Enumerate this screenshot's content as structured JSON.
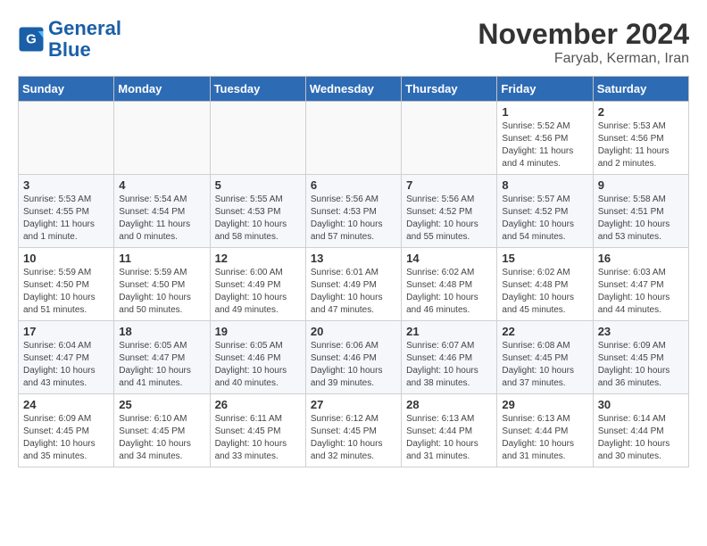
{
  "logo": {
    "line1": "General",
    "line2": "Blue"
  },
  "title": "November 2024",
  "subtitle": "Faryab, Kerman, Iran",
  "headers": [
    "Sunday",
    "Monday",
    "Tuesday",
    "Wednesday",
    "Thursday",
    "Friday",
    "Saturday"
  ],
  "weeks": [
    [
      {
        "day": "",
        "text": ""
      },
      {
        "day": "",
        "text": ""
      },
      {
        "day": "",
        "text": ""
      },
      {
        "day": "",
        "text": ""
      },
      {
        "day": "",
        "text": ""
      },
      {
        "day": "1",
        "text": "Sunrise: 5:52 AM\nSunset: 4:56 PM\nDaylight: 11 hours\nand 4 minutes."
      },
      {
        "day": "2",
        "text": "Sunrise: 5:53 AM\nSunset: 4:56 PM\nDaylight: 11 hours\nand 2 minutes."
      }
    ],
    [
      {
        "day": "3",
        "text": "Sunrise: 5:53 AM\nSunset: 4:55 PM\nDaylight: 11 hours\nand 1 minute."
      },
      {
        "day": "4",
        "text": "Sunrise: 5:54 AM\nSunset: 4:54 PM\nDaylight: 11 hours\nand 0 minutes."
      },
      {
        "day": "5",
        "text": "Sunrise: 5:55 AM\nSunset: 4:53 PM\nDaylight: 10 hours\nand 58 minutes."
      },
      {
        "day": "6",
        "text": "Sunrise: 5:56 AM\nSunset: 4:53 PM\nDaylight: 10 hours\nand 57 minutes."
      },
      {
        "day": "7",
        "text": "Sunrise: 5:56 AM\nSunset: 4:52 PM\nDaylight: 10 hours\nand 55 minutes."
      },
      {
        "day": "8",
        "text": "Sunrise: 5:57 AM\nSunset: 4:52 PM\nDaylight: 10 hours\nand 54 minutes."
      },
      {
        "day": "9",
        "text": "Sunrise: 5:58 AM\nSunset: 4:51 PM\nDaylight: 10 hours\nand 53 minutes."
      }
    ],
    [
      {
        "day": "10",
        "text": "Sunrise: 5:59 AM\nSunset: 4:50 PM\nDaylight: 10 hours\nand 51 minutes."
      },
      {
        "day": "11",
        "text": "Sunrise: 5:59 AM\nSunset: 4:50 PM\nDaylight: 10 hours\nand 50 minutes."
      },
      {
        "day": "12",
        "text": "Sunrise: 6:00 AM\nSunset: 4:49 PM\nDaylight: 10 hours\nand 49 minutes."
      },
      {
        "day": "13",
        "text": "Sunrise: 6:01 AM\nSunset: 4:49 PM\nDaylight: 10 hours\nand 47 minutes."
      },
      {
        "day": "14",
        "text": "Sunrise: 6:02 AM\nSunset: 4:48 PM\nDaylight: 10 hours\nand 46 minutes."
      },
      {
        "day": "15",
        "text": "Sunrise: 6:02 AM\nSunset: 4:48 PM\nDaylight: 10 hours\nand 45 minutes."
      },
      {
        "day": "16",
        "text": "Sunrise: 6:03 AM\nSunset: 4:47 PM\nDaylight: 10 hours\nand 44 minutes."
      }
    ],
    [
      {
        "day": "17",
        "text": "Sunrise: 6:04 AM\nSunset: 4:47 PM\nDaylight: 10 hours\nand 43 minutes."
      },
      {
        "day": "18",
        "text": "Sunrise: 6:05 AM\nSunset: 4:47 PM\nDaylight: 10 hours\nand 41 minutes."
      },
      {
        "day": "19",
        "text": "Sunrise: 6:05 AM\nSunset: 4:46 PM\nDaylight: 10 hours\nand 40 minutes."
      },
      {
        "day": "20",
        "text": "Sunrise: 6:06 AM\nSunset: 4:46 PM\nDaylight: 10 hours\nand 39 minutes."
      },
      {
        "day": "21",
        "text": "Sunrise: 6:07 AM\nSunset: 4:46 PM\nDaylight: 10 hours\nand 38 minutes."
      },
      {
        "day": "22",
        "text": "Sunrise: 6:08 AM\nSunset: 4:45 PM\nDaylight: 10 hours\nand 37 minutes."
      },
      {
        "day": "23",
        "text": "Sunrise: 6:09 AM\nSunset: 4:45 PM\nDaylight: 10 hours\nand 36 minutes."
      }
    ],
    [
      {
        "day": "24",
        "text": "Sunrise: 6:09 AM\nSunset: 4:45 PM\nDaylight: 10 hours\nand 35 minutes."
      },
      {
        "day": "25",
        "text": "Sunrise: 6:10 AM\nSunset: 4:45 PM\nDaylight: 10 hours\nand 34 minutes."
      },
      {
        "day": "26",
        "text": "Sunrise: 6:11 AM\nSunset: 4:45 PM\nDaylight: 10 hours\nand 33 minutes."
      },
      {
        "day": "27",
        "text": "Sunrise: 6:12 AM\nSunset: 4:45 PM\nDaylight: 10 hours\nand 32 minutes."
      },
      {
        "day": "28",
        "text": "Sunrise: 6:13 AM\nSunset: 4:44 PM\nDaylight: 10 hours\nand 31 minutes."
      },
      {
        "day": "29",
        "text": "Sunrise: 6:13 AM\nSunset: 4:44 PM\nDaylight: 10 hours\nand 31 minutes."
      },
      {
        "day": "30",
        "text": "Sunrise: 6:14 AM\nSunset: 4:44 PM\nDaylight: 10 hours\nand 30 minutes."
      }
    ]
  ]
}
